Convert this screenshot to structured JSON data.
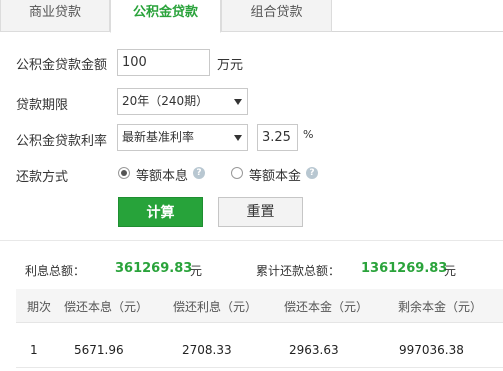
{
  "tabs": [
    {
      "label": "商业贷款",
      "active": false
    },
    {
      "label": "公积金贷款",
      "active": true
    },
    {
      "label": "组合贷款",
      "active": false
    }
  ],
  "form": {
    "amount_label": "公积金贷款金额",
    "amount_value": "100",
    "amount_unit": "万元",
    "term_label": "贷款期限",
    "term_value": "20年（240期）",
    "rate_label": "公积金贷款利率",
    "rate_type_value": "最新基准利率",
    "rate_value": "3.25",
    "rate_unit": "%",
    "method_label": "还款方式",
    "method_options": [
      {
        "label": "等额本息",
        "selected": true
      },
      {
        "label": "等额本金",
        "selected": false
      }
    ]
  },
  "buttons": {
    "calculate": "计算",
    "reset": "重置"
  },
  "summary": {
    "interest_label": "利息总额：",
    "interest_value": "361269.83",
    "interest_unit": "元",
    "total_label": "累计还款总额：",
    "total_value": "1361269.83",
    "total_unit": "元"
  },
  "table": {
    "headers": [
      "期次",
      "偿还本息（元）",
      "偿还利息（元）",
      "偿还本金（元）",
      "剩余本金（元）"
    ],
    "rows": [
      [
        "1",
        "5671.96",
        "2708.33",
        "2963.63",
        "997036.38"
      ]
    ]
  },
  "colors": {
    "accent": "#2aa33b"
  },
  "icons": {
    "help": "question-icon"
  }
}
